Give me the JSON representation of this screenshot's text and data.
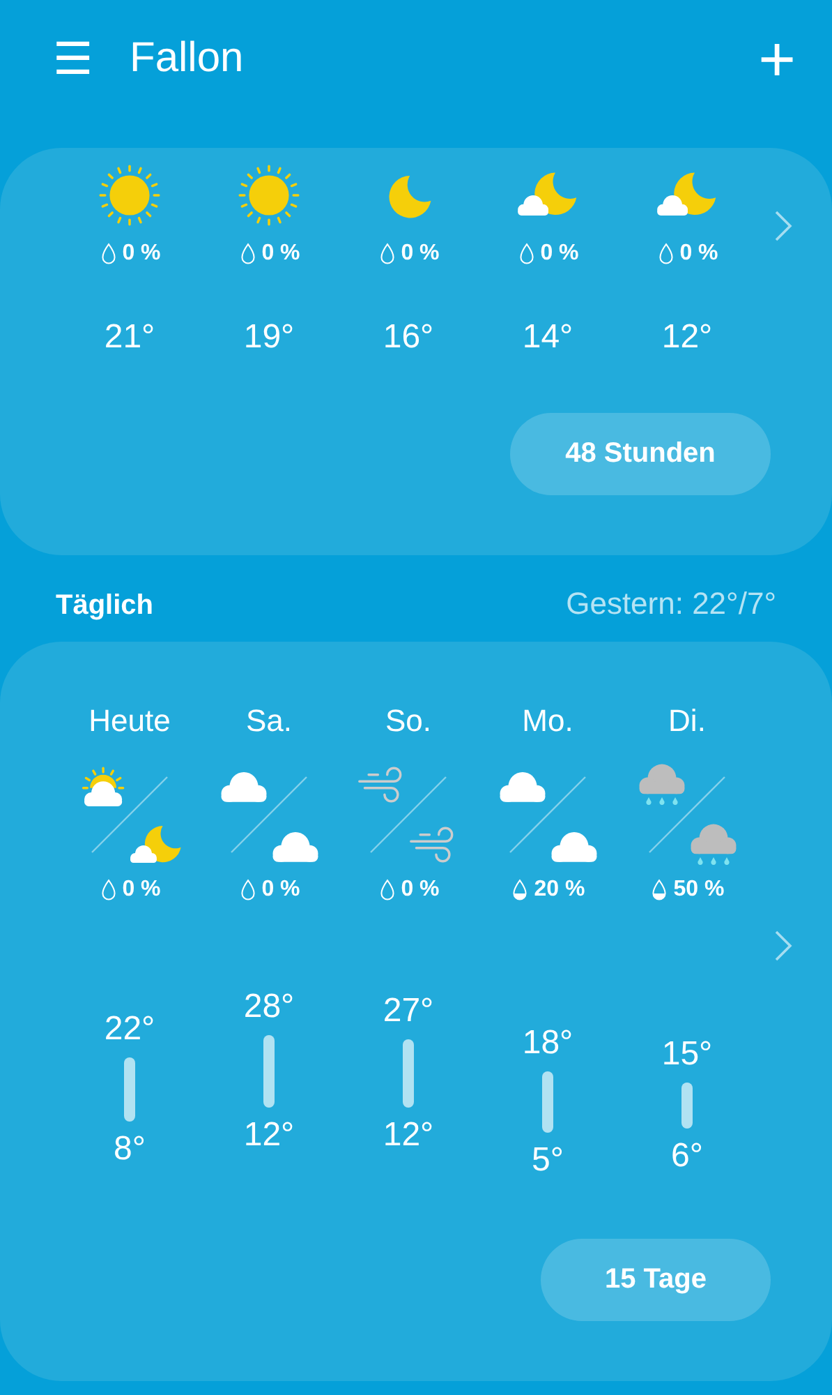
{
  "header": {
    "menu": "☰",
    "title": "Fallon",
    "add": "+"
  },
  "hourly": {
    "items": [
      {
        "icon": {
          "kind": "sun"
        },
        "drop_filled": false,
        "precip": "0 %",
        "temp": "21°"
      },
      {
        "icon": {
          "kind": "sun"
        },
        "drop_filled": false,
        "precip": "0 %",
        "temp": "19°"
      },
      {
        "icon": {
          "kind": "moon"
        },
        "drop_filled": false,
        "precip": "0 %",
        "temp": "16°"
      },
      {
        "icon": {
          "kind": "moon-cloud"
        },
        "drop_filled": false,
        "precip": "0 %",
        "temp": "14°"
      },
      {
        "icon": {
          "kind": "moon-cloud"
        },
        "drop_filled": false,
        "precip": "0 %",
        "temp": "12°"
      }
    ],
    "button": "48 Stunden"
  },
  "daily_header": {
    "title": "Täglich",
    "yesterday": "Gestern: 22°/7°"
  },
  "daily": {
    "items": [
      {
        "day": "Heute",
        "day_icon": {
          "kind": "sun-cloud"
        },
        "night_icon": {
          "kind": "moon-cloud"
        },
        "drop_filled": false,
        "precip": "0 %",
        "high": "22°",
        "low": "8°"
      },
      {
        "day": "Sa.",
        "day_icon": {
          "kind": "cloud"
        },
        "night_icon": {
          "kind": "cloud"
        },
        "drop_filled": false,
        "precip": "0 %",
        "high": "28°",
        "low": "12°"
      },
      {
        "day": "So.",
        "day_icon": {
          "kind": "wind"
        },
        "night_icon": {
          "kind": "wind"
        },
        "drop_filled": false,
        "precip": "0 %",
        "high": "27°",
        "low": "12°"
      },
      {
        "day": "Mo.",
        "day_icon": {
          "kind": "cloud"
        },
        "night_icon": {
          "kind": "cloud"
        },
        "drop_filled": true,
        "precip": "20 %",
        "high": "18°",
        "low": "5°"
      },
      {
        "day": "Di.",
        "day_icon": {
          "kind": "rain"
        },
        "night_icon": {
          "kind": "rain"
        },
        "drop_filled": true,
        "precip": "50 %",
        "high": "15°",
        "low": "6°"
      }
    ],
    "button": "15 Tage"
  }
}
